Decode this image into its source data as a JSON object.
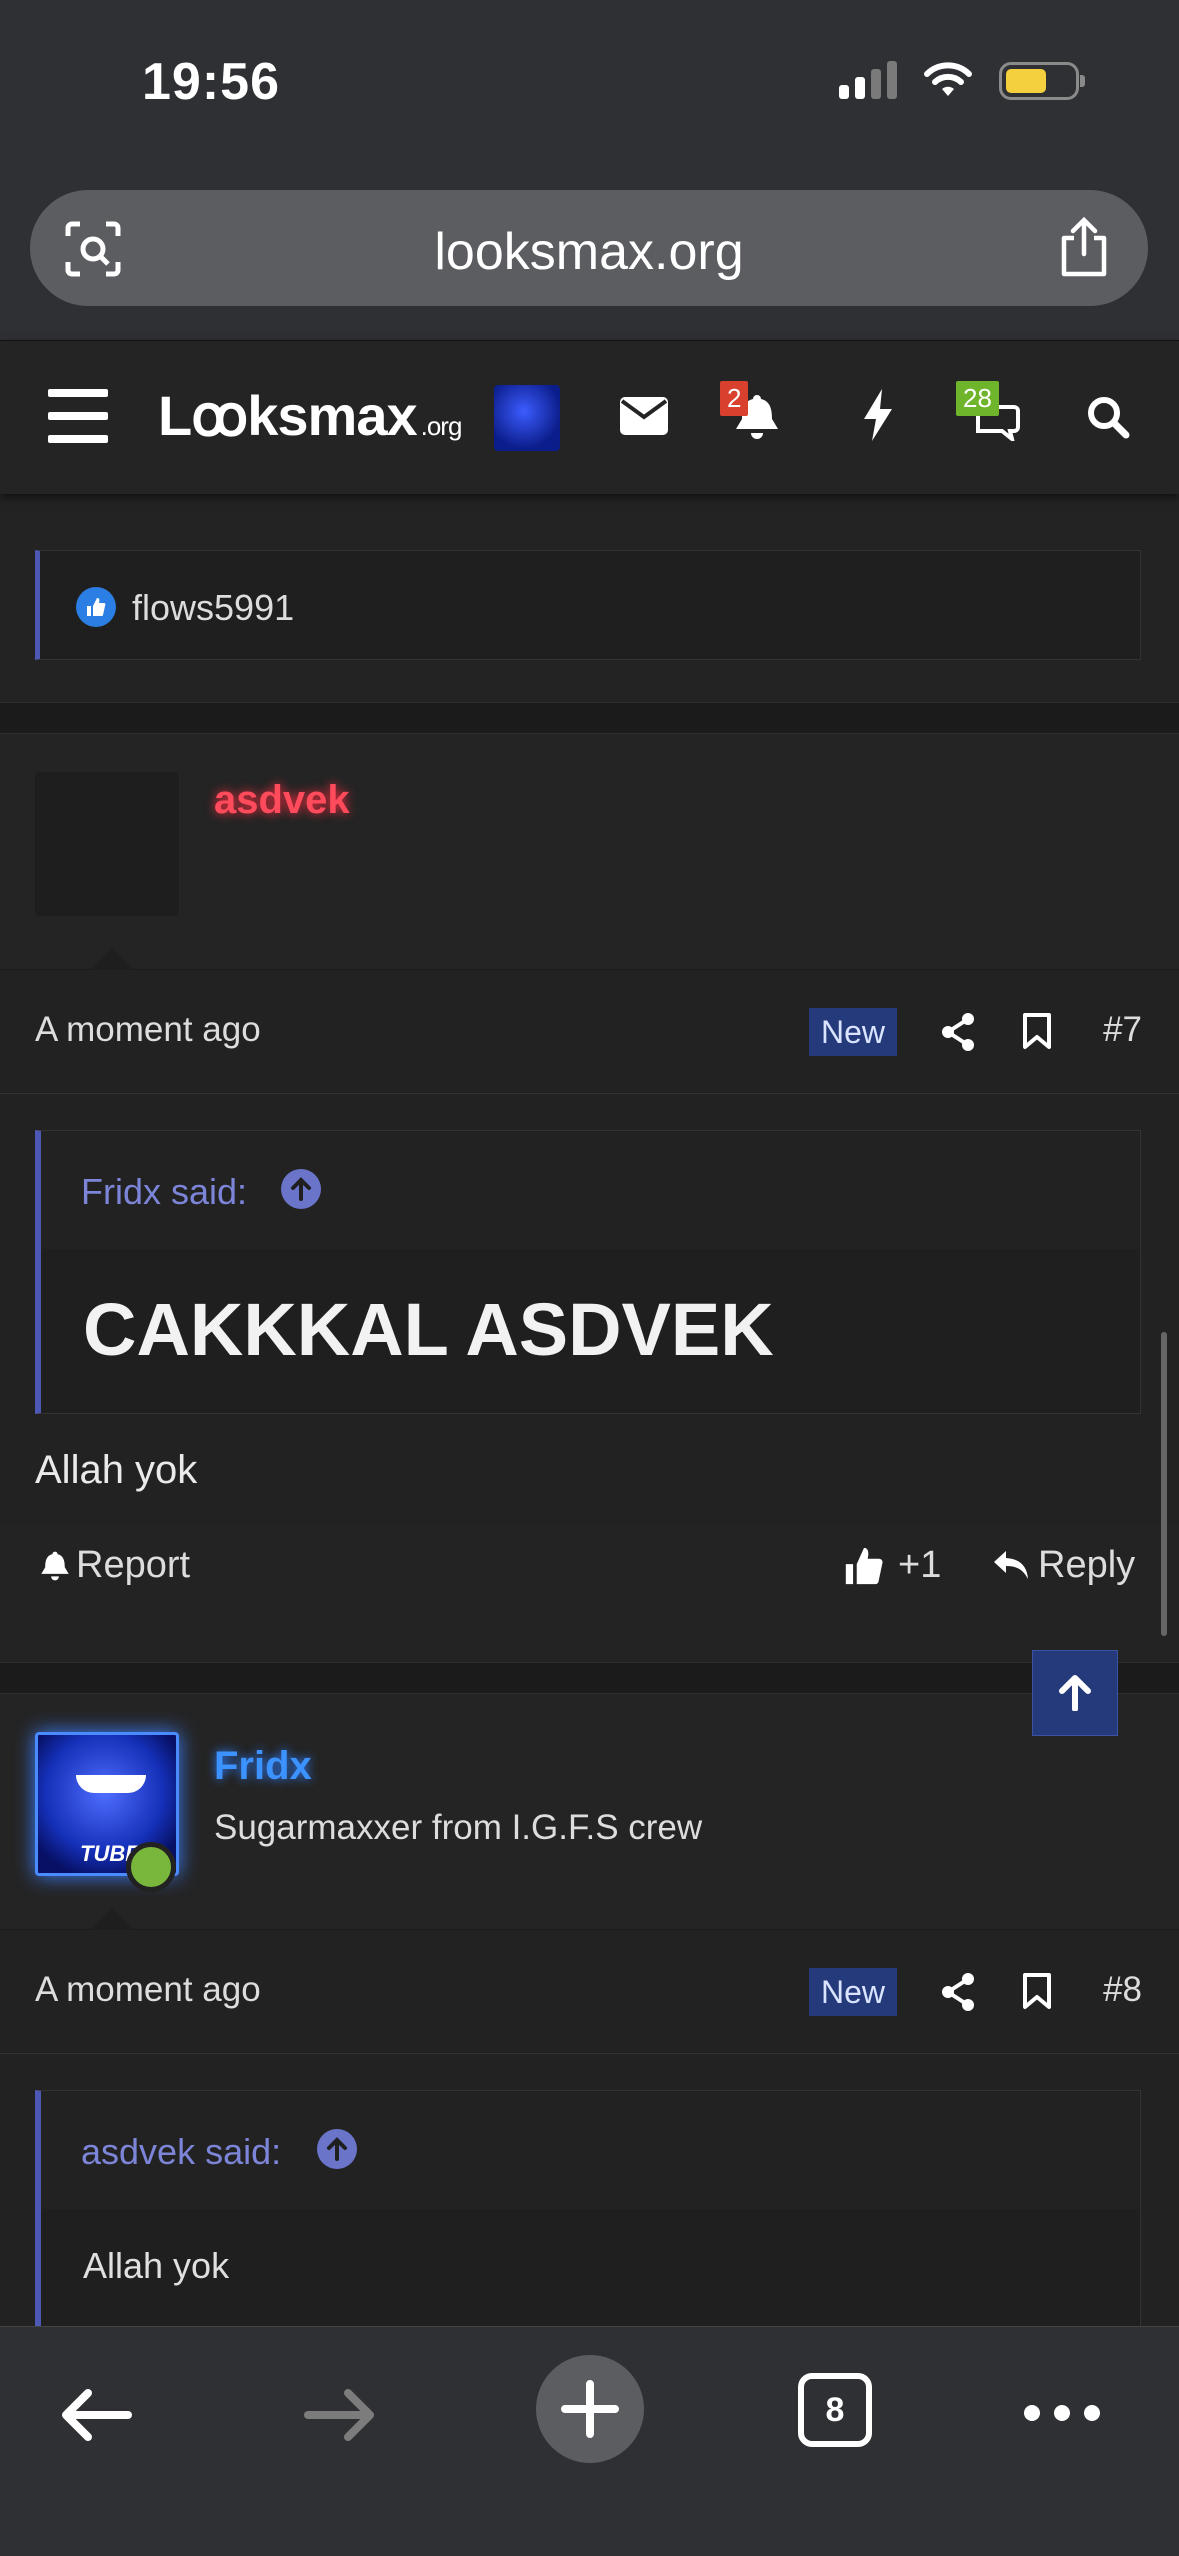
{
  "status_bar": {
    "time": "19:56"
  },
  "browser": {
    "url": "looksmax.org",
    "tab_count": "8"
  },
  "site_header": {
    "logo": "Lꝏksmax",
    "logo_suffix": ".org",
    "alerts_badge": "2",
    "conversations_badge": "28"
  },
  "reactions": {
    "user": "flows5991"
  },
  "posts": [
    {
      "author": "asdvek",
      "time": "A moment ago",
      "new_label": "New",
      "number": "#7",
      "quote_author": "Fridx said:",
      "quote_text": "CAKKKAL ASDVEK",
      "body": "Allah yok",
      "report_label": "Report",
      "like_count": "+1",
      "reply_label": "Reply"
    },
    {
      "author": "Fridx",
      "user_title": "Sugarmaxxer from I.G.F.S crew",
      "avatar_text": "TUBE",
      "time": "A moment ago",
      "new_label": "New",
      "number": "#8",
      "quote_author": "asdvek said:",
      "quote_text": "Allah yok"
    }
  ],
  "colors": {
    "accent": "#4c58b4",
    "new_badge": "#243a7b",
    "alert_red": "#d9412e",
    "online_green": "#78b73b",
    "username_red": "#ff4b5c",
    "username_blue": "#3c93ff"
  }
}
